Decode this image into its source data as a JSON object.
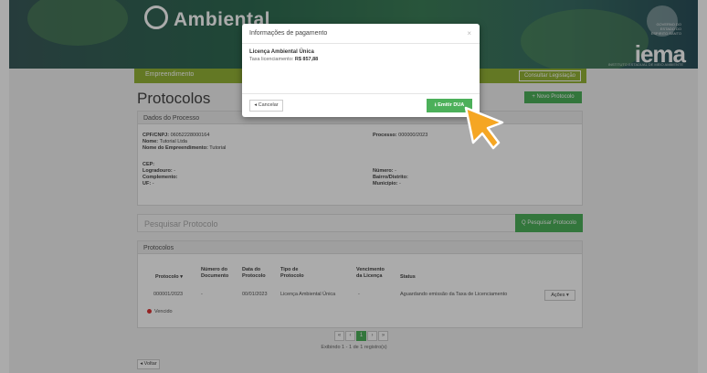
{
  "banner": {
    "brand_top": "Licenciamento",
    "brand": "Ambiental",
    "gov_text": "GOVERNO DO ESTADO DO ESPIRITO SANTO",
    "agency": "iema",
    "agency_sub": "INSTITUTO ESTADUAL DE MEIO AMBIENTE"
  },
  "nav": {
    "link": "Empreendimento",
    "consult_label": "Consultar Legislação"
  },
  "page": {
    "title": "Protocolos",
    "new_button": "+ Novo Protocolo"
  },
  "process": {
    "header": "Dados do Processo",
    "cpf_label": "CPF/CNPJ:",
    "cpf": "06052228000164",
    "name_label": "Nome:",
    "name": "Tutorial Ltda",
    "enterprise_label": "Nome do Empreendimento:",
    "enterprise": "Tutorial",
    "process_label": "Processo:",
    "process": "000000/2023",
    "cep_label": "CEP:",
    "cep": "",
    "street_label": "Logradouro:",
    "street": "-",
    "complement_label": "Complemento:",
    "complement": "",
    "uf_label": "UF:",
    "uf": "-",
    "number_label": "Número:",
    "number": "-",
    "district_label": "Bairro/Distrito:",
    "district": "",
    "city_label": "Município:",
    "city": "-"
  },
  "search": {
    "label": "Pesquisar Protocolo",
    "button": "Q Pesquisar Protocolo"
  },
  "protocols": {
    "header": "Protocolos",
    "columns": {
      "protocol": "Protocolo ▾",
      "doc_number_1": "Número do",
      "doc_number_2": "Documento",
      "date_1": "Data do",
      "date_2": "Protocolo",
      "type_1": "Tipo de",
      "type_2": "Protocolo",
      "validity_1": "Vencimento",
      "validity_2": "da Licença",
      "status": "Status"
    },
    "rows": [
      {
        "protocol": "000001/2023",
        "doc_number": "-",
        "date": "00/01/2023",
        "type": "Licença Ambiental Única",
        "validity": "-",
        "status": "Aguardando emissão da Taxa de Licenciamento",
        "actions": "Ações ▾"
      }
    ],
    "legend": "Vencido"
  },
  "pagination": {
    "prev": "‹",
    "first": "«",
    "current": "1",
    "next": "›",
    "last": "»",
    "summary": "Exibindo 1 - 1 de 1 registro(s)"
  },
  "back_button": "◂ Voltar",
  "modal": {
    "title": "Informações de pagamento",
    "close": "×",
    "license": "Licença Ambiental Única",
    "fee_label": "Taxa licenciamento:",
    "fee_value": "R$ 857,88",
    "cancel": "◂ Cancelar",
    "emit": "⭳ Emitir DUA"
  },
  "colors": {
    "green": "#4cb05a",
    "nav_green": "#94b437",
    "cursor": "#f5a623"
  }
}
